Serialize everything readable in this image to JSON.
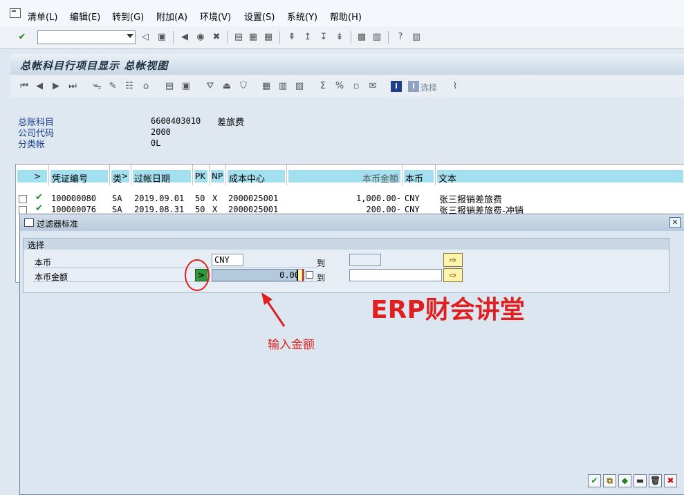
{
  "menu": [
    "清单(L)",
    "编辑(E)",
    "转到(G)",
    "附加(A)",
    "环境(V)",
    "设置(S)",
    "系统(Y)",
    "帮助(H)"
  ],
  "title": "总帐科目行项目显示 总帐视图",
  "app_toolbar": {
    "select_label": "选择"
  },
  "header": {
    "account_label": "总账科目",
    "account_value": "6600403010",
    "account_desc": "差旅费",
    "company_label": "公司代码",
    "company_value": "2000",
    "ledger_label": "分类帐",
    "ledger_value": "0L"
  },
  "table": {
    "columns": [
      "凭证编号",
      "类",
      "过帐日期",
      "PK",
      "NP",
      "成本中心",
      "本币金额",
      "本币",
      "文本"
    ],
    "rows": [
      {
        "doc": "100000080",
        "type": "SA",
        "date": "2019.09.01",
        "pk": "50",
        "np": "X",
        "cc": "2000025001",
        "amount": "1,000.00-",
        "cur": "CNY",
        "text": "张三报销差旅费"
      },
      {
        "doc": "100000076",
        "type": "SA",
        "date": "2019.08.31",
        "pk": "50",
        "np": "X",
        "cc": "2000025001",
        "amount": "200.00-",
        "cur": "CNY",
        "text": "张三报销差旅费-冲销"
      }
    ]
  },
  "dialog": {
    "title": "过滤器标准",
    "group_label": "选择",
    "fields": [
      {
        "label": "本币",
        "from_value": "CNY",
        "to_label": "到",
        "to_value": ""
      },
      {
        "label": "本币金额",
        "operator": ">",
        "from_value": "0.00",
        "to_label": "到",
        "to_value": ""
      }
    ]
  },
  "annotations": {
    "hint": "输入金额",
    "watermark": "ERP财会讲堂"
  },
  "colors": {
    "annotation_red": "#e02020",
    "header_blue": "#a3e0ef",
    "operator_green": "#2f9a3a"
  }
}
